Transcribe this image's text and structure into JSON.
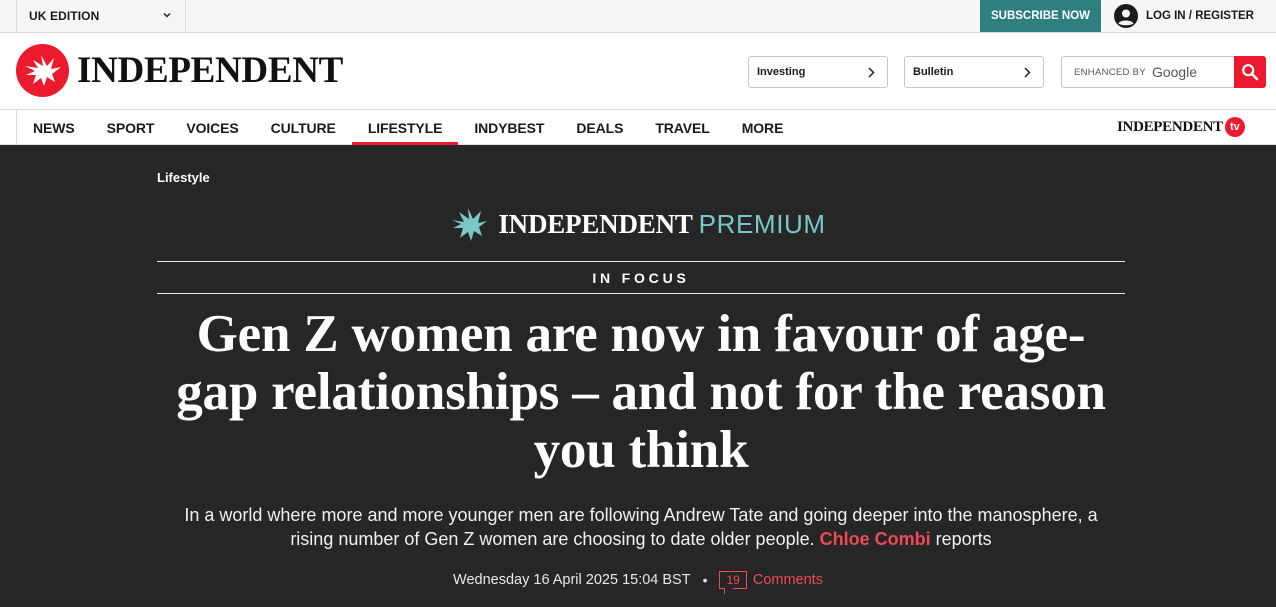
{
  "topbar": {
    "edition_label": "UK EDITION",
    "subscribe_label": "SUBSCRIBE NOW",
    "login_label": "LOG IN / REGISTER"
  },
  "masthead": {
    "logo_text": "INDEPENDENT",
    "pills": [
      {
        "label": "Investing"
      },
      {
        "label": "Bulletin"
      }
    ],
    "search": {
      "enhanced_label": "ENHANCED BY",
      "google_label": "Google"
    }
  },
  "nav": {
    "items": [
      {
        "label": "NEWS"
      },
      {
        "label": "SPORT"
      },
      {
        "label": "VOICES"
      },
      {
        "label": "CULTURE"
      },
      {
        "label": "LIFESTYLE",
        "active": true
      },
      {
        "label": "INDYBEST"
      },
      {
        "label": "DEALS"
      },
      {
        "label": "TRAVEL"
      },
      {
        "label": "MORE"
      }
    ],
    "tv_logo_text": "INDEPENDENT",
    "tv_badge": "tv"
  },
  "article": {
    "breadcrumb": "Lifestyle",
    "premium_wordmark": "INDEPENDENT",
    "premium_label": "PREMIUM",
    "section_label": "IN FOCUS",
    "headline": "Gen Z women are now in favour of age-gap relationships – and not for the reason you think",
    "standfirst": "In a world where more and more younger men are following Andrew Tate and going deeper into the manosphere, a rising number of Gen Z women are choosing to date older people.",
    "author": "Chloe Combi",
    "author_suffix": "reports",
    "date": "Wednesday 16 April 2025 15:04 BST",
    "comment_count": "19",
    "comments_label": "Comments"
  },
  "colors": {
    "accent_red": "#ec1a2e",
    "subscribe_teal": "#2f7e80",
    "premium_teal": "#79c7c7",
    "hero_bg": "#262626",
    "link_red": "#ec4a57"
  },
  "icons": {
    "edition_chevron": "chevron-down-icon",
    "login_avatar": "user-avatar-icon",
    "pill_arrow": "chevron-right-icon",
    "search_button": "search-icon",
    "logo": "eagle-logo-icon"
  }
}
